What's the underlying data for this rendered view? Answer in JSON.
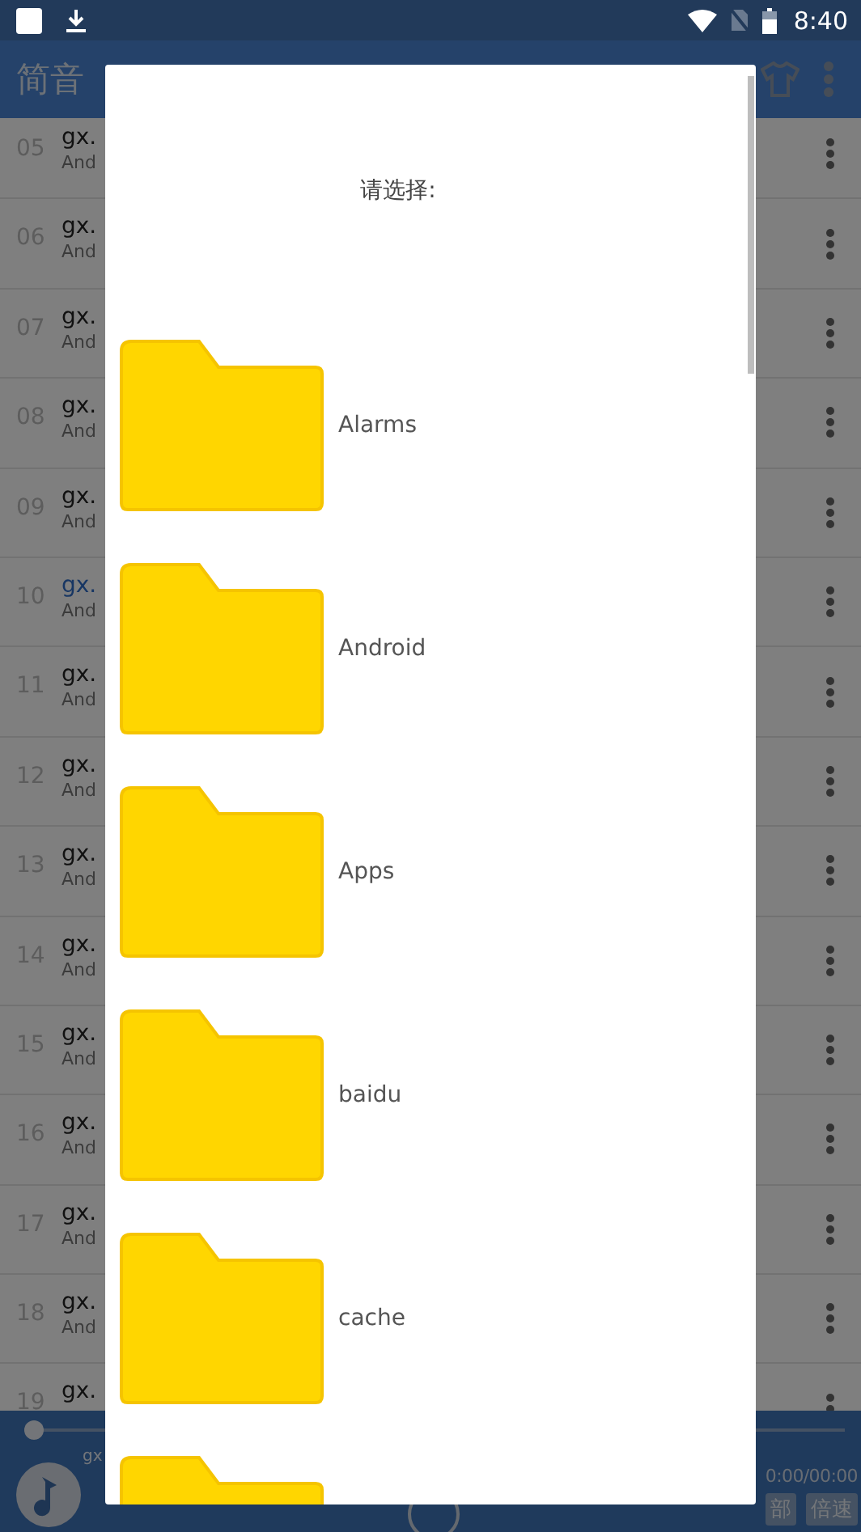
{
  "status_bar": {
    "time": "8:40"
  },
  "app_bar": {
    "title": "简音"
  },
  "tracks": [
    {
      "number": "05",
      "title": "gx.",
      "subtitle": "And",
      "playing": false
    },
    {
      "number": "06",
      "title": "gx.",
      "subtitle": "And",
      "playing": false
    },
    {
      "number": "07",
      "title": "gx.",
      "subtitle": "And",
      "playing": false
    },
    {
      "number": "08",
      "title": "gx.",
      "subtitle": "And",
      "playing": false
    },
    {
      "number": "09",
      "title": "gx.",
      "subtitle": "And",
      "playing": false
    },
    {
      "number": "10",
      "title": "gx.",
      "subtitle": "And",
      "playing": true
    },
    {
      "number": "11",
      "title": "gx.",
      "subtitle": "And",
      "playing": false
    },
    {
      "number": "12",
      "title": "gx.",
      "subtitle": "And",
      "playing": false
    },
    {
      "number": "13",
      "title": "gx.",
      "subtitle": "And",
      "playing": false
    },
    {
      "number": "14",
      "title": "gx.",
      "subtitle": "And",
      "playing": false
    },
    {
      "number": "15",
      "title": "gx.",
      "subtitle": "And",
      "playing": false
    },
    {
      "number": "16",
      "title": "gx.",
      "subtitle": "And",
      "playing": false
    },
    {
      "number": "17",
      "title": "gx.",
      "subtitle": "And",
      "playing": false
    },
    {
      "number": "18",
      "title": "gx.",
      "subtitle": "And",
      "playing": false
    },
    {
      "number": "19",
      "title": "gx.",
      "playing": false
    }
  ],
  "player": {
    "track_title": "gx",
    "time": "0:00/00:00",
    "level": 0,
    "buttons": [
      "部",
      "倍速"
    ]
  },
  "dialog": {
    "title": "请选择:",
    "folders": [
      {
        "kind": "folder",
        "name": "Alarms"
      },
      {
        "kind": "folder",
        "name": "Android"
      },
      {
        "kind": "folder",
        "name": "Apps"
      },
      {
        "kind": "folder",
        "name": "baidu"
      },
      {
        "kind": "folder",
        "name": "cache"
      },
      {
        "kind": "folder"
      }
    ]
  }
}
